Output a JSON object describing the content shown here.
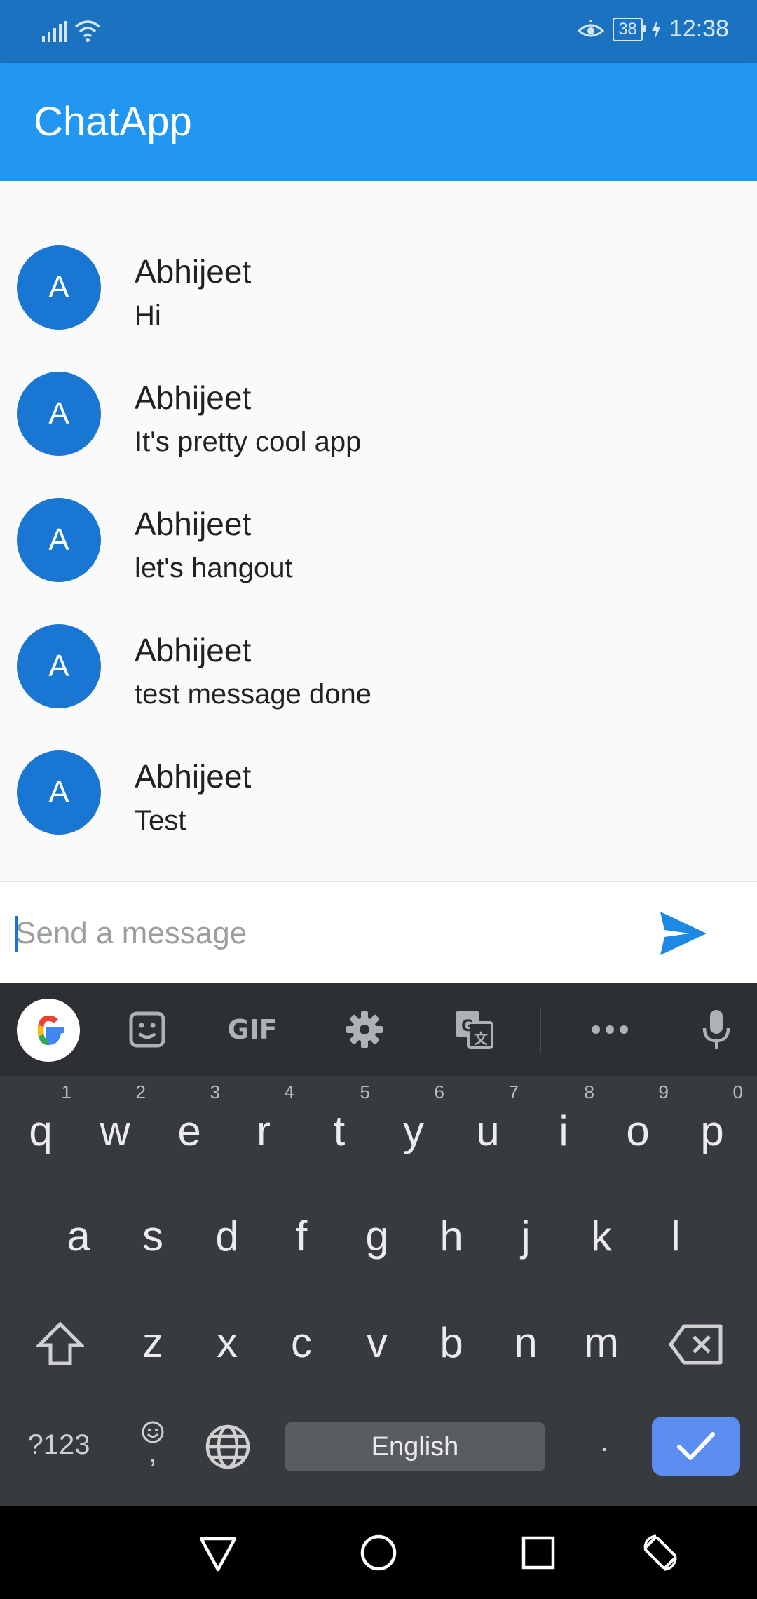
{
  "status_bar": {
    "battery": "38",
    "time": "12:38",
    "icons": [
      "signal-icon",
      "wifi-icon",
      "eye-icon",
      "battery-icon",
      "charging-icon"
    ]
  },
  "app_bar": {
    "title": "ChatApp",
    "color": "#2196f3"
  },
  "messages": [
    {
      "avatar": "A",
      "name": "Abhijeet",
      "text": "Hi"
    },
    {
      "avatar": "A",
      "name": "Abhijeet",
      "text": "It's pretty cool app"
    },
    {
      "avatar": "A",
      "name": "Abhijeet",
      "text": "let's hangout"
    },
    {
      "avatar": "A",
      "name": "Abhijeet",
      "text": "test message done"
    },
    {
      "avatar": "A",
      "name": "Abhijeet",
      "text": "Test"
    }
  ],
  "composer": {
    "placeholder": "Send a message",
    "value": "",
    "send_icon": "send-icon"
  },
  "keyboard": {
    "toolbar": {
      "gif_label": "GIF",
      "icons": [
        "google-icon",
        "sticker-icon",
        "gif-icon",
        "settings-icon",
        "translate-icon",
        "more-icon",
        "mic-icon"
      ]
    },
    "row1": [
      "q",
      "w",
      "e",
      "r",
      "t",
      "y",
      "u",
      "i",
      "o",
      "p"
    ],
    "row1_hints": [
      "1",
      "2",
      "3",
      "4",
      "5",
      "6",
      "7",
      "8",
      "9",
      "0"
    ],
    "row2": [
      "a",
      "s",
      "d",
      "f",
      "g",
      "h",
      "j",
      "k",
      "l"
    ],
    "row3": [
      "z",
      "x",
      "c",
      "v",
      "b",
      "n",
      "m"
    ],
    "symbols_label": "?123",
    "comma_label": ",",
    "space_label": "English",
    "period_label": "."
  },
  "nav_bar": {
    "icons": [
      "back-icon",
      "home-icon",
      "recents-icon",
      "rotate-icon"
    ]
  }
}
